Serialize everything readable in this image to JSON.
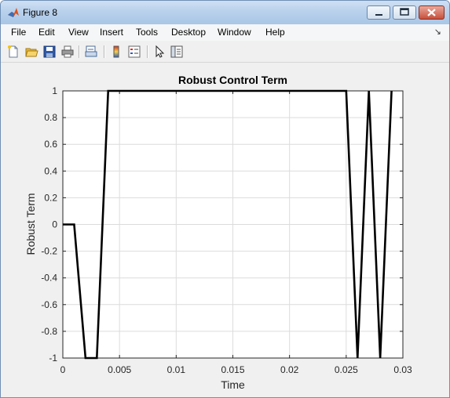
{
  "window": {
    "title": "Figure 8"
  },
  "menu": {
    "items": [
      "File",
      "Edit",
      "View",
      "Insert",
      "Tools",
      "Desktop",
      "Window",
      "Help"
    ]
  },
  "toolbar": {
    "buttons": [
      "new-figure",
      "open-file",
      "save-figure",
      "print-figure",
      "link-plot",
      "insert-colorbar",
      "insert-legend",
      "edit-plot",
      "property-inspector"
    ]
  },
  "chart_data": {
    "type": "line",
    "title": "Robust Control Term",
    "xlabel": "Time",
    "ylabel": "Robust Term",
    "xlim": [
      0,
      0.03
    ],
    "ylim": [
      -1,
      1
    ],
    "xticks": [
      0,
      0.005,
      0.01,
      0.015,
      0.02,
      0.025,
      0.03
    ],
    "xtick_labels": [
      "0",
      "0.005",
      "0.01",
      "0.015",
      "0.02",
      "0.025",
      "0.03"
    ],
    "yticks": [
      -1,
      -0.8,
      -0.6,
      -0.4,
      -0.2,
      0,
      0.2,
      0.4,
      0.6,
      0.8,
      1
    ],
    "ytick_labels": [
      "-1",
      "-0.8",
      "-0.6",
      "-0.4",
      "-0.2",
      "0",
      "0.2",
      "0.4",
      "0.6",
      "0.8",
      "1"
    ],
    "grid": true,
    "series": [
      {
        "color": "#000000",
        "x": [
          0,
          0.001,
          0.002,
          0.003,
          0.004,
          0.025,
          0.026,
          0.027,
          0.028,
          0.029
        ],
        "y": [
          0,
          0,
          -1,
          -1,
          1,
          1,
          -1,
          1,
          -1,
          1
        ]
      }
    ]
  }
}
